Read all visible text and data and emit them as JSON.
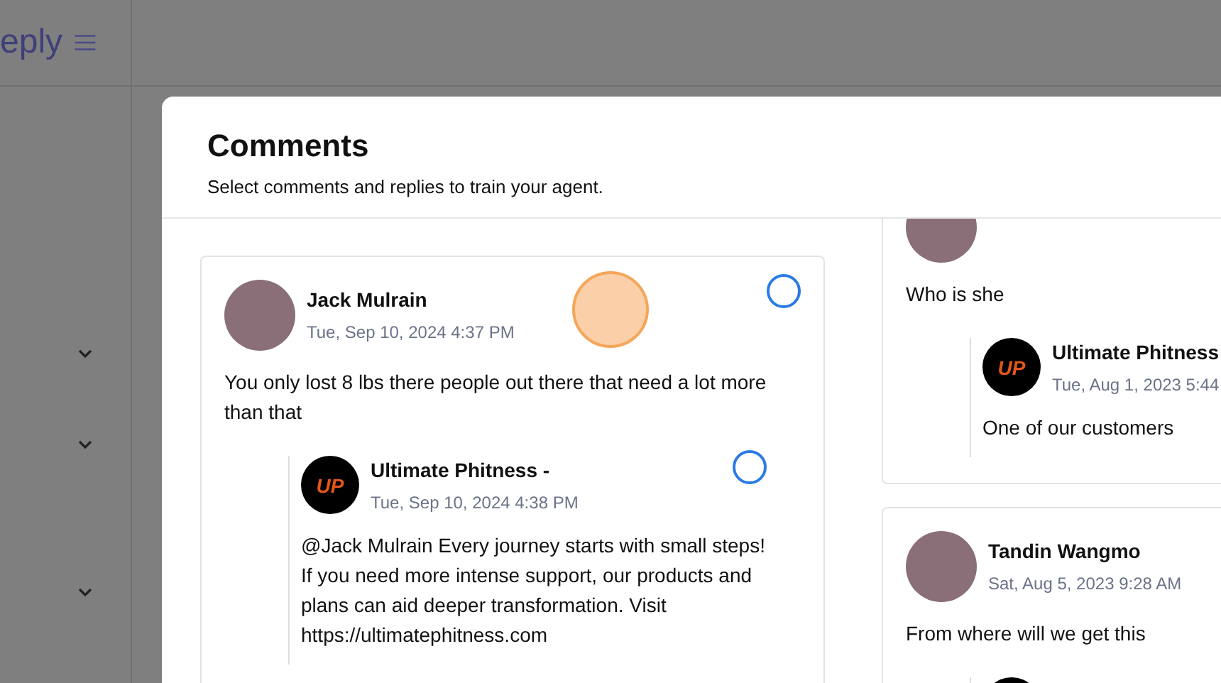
{
  "header": {
    "brand": "eply"
  },
  "sidebar": {
    "sections": [
      {
        "expanded": false
      },
      {
        "expanded": false
      },
      {
        "expanded": false
      }
    ]
  },
  "modal": {
    "title": "Comments",
    "subtitle": "Select comments and replies to train your agent.",
    "left_column": [
      {
        "author": "Jack Mulrain",
        "date": "Tue, Sep 10, 2024 4:37 PM",
        "text": "You only lost 8 lbs there people out there that need a lot more than that",
        "selected": false,
        "replies": [
          {
            "author": "Ultimate Phitness -",
            "avatar_logo": "UP",
            "date": "Tue, Sep 10, 2024 4:38 PM",
            "text": "@Jack Mulrain Every journey starts with small steps! If you need more intense support, our products and plans can aid deeper transformation. Visit https://ultimatephitness.com",
            "selected": false
          }
        ]
      }
    ],
    "right_column": [
      {
        "text": "Who is she",
        "replies": [
          {
            "author": "Ultimate Phitness",
            "avatar_logo": "UP",
            "date": "Tue, Aug 1, 2023 5:44",
            "text": "One of our customers"
          }
        ]
      },
      {
        "author": "Tandin Wangmo",
        "date": "Sat, Aug 5, 2023 9:28 AM",
        "text": "From where will we get this",
        "more_replies_below": true
      }
    ]
  }
}
